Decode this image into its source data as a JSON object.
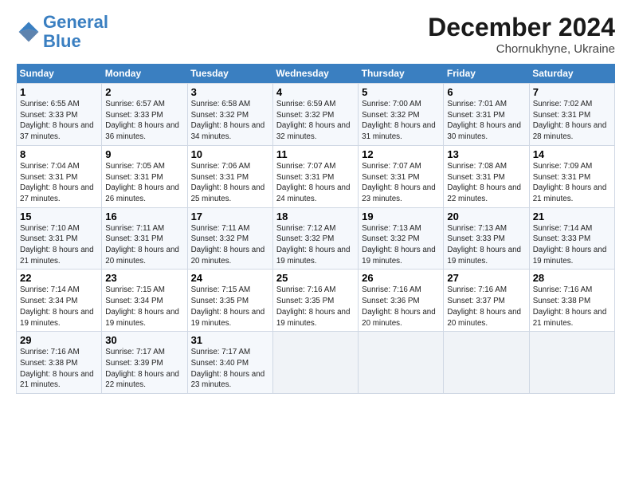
{
  "logo": {
    "line1": "General",
    "line2": "Blue"
  },
  "title": "December 2024",
  "subtitle": "Chornukhyne, Ukraine",
  "days_header": [
    "Sunday",
    "Monday",
    "Tuesday",
    "Wednesday",
    "Thursday",
    "Friday",
    "Saturday"
  ],
  "weeks": [
    [
      {
        "day": "1",
        "sunrise": "Sunrise: 6:55 AM",
        "sunset": "Sunset: 3:33 PM",
        "daylight": "Daylight: 8 hours and 37 minutes."
      },
      {
        "day": "2",
        "sunrise": "Sunrise: 6:57 AM",
        "sunset": "Sunset: 3:33 PM",
        "daylight": "Daylight: 8 hours and 36 minutes."
      },
      {
        "day": "3",
        "sunrise": "Sunrise: 6:58 AM",
        "sunset": "Sunset: 3:32 PM",
        "daylight": "Daylight: 8 hours and 34 minutes."
      },
      {
        "day": "4",
        "sunrise": "Sunrise: 6:59 AM",
        "sunset": "Sunset: 3:32 PM",
        "daylight": "Daylight: 8 hours and 32 minutes."
      },
      {
        "day": "5",
        "sunrise": "Sunrise: 7:00 AM",
        "sunset": "Sunset: 3:32 PM",
        "daylight": "Daylight: 8 hours and 31 minutes."
      },
      {
        "day": "6",
        "sunrise": "Sunrise: 7:01 AM",
        "sunset": "Sunset: 3:31 PM",
        "daylight": "Daylight: 8 hours and 30 minutes."
      },
      {
        "day": "7",
        "sunrise": "Sunrise: 7:02 AM",
        "sunset": "Sunset: 3:31 PM",
        "daylight": "Daylight: 8 hours and 28 minutes."
      }
    ],
    [
      {
        "day": "8",
        "sunrise": "Sunrise: 7:04 AM",
        "sunset": "Sunset: 3:31 PM",
        "daylight": "Daylight: 8 hours and 27 minutes."
      },
      {
        "day": "9",
        "sunrise": "Sunrise: 7:05 AM",
        "sunset": "Sunset: 3:31 PM",
        "daylight": "Daylight: 8 hours and 26 minutes."
      },
      {
        "day": "10",
        "sunrise": "Sunrise: 7:06 AM",
        "sunset": "Sunset: 3:31 PM",
        "daylight": "Daylight: 8 hours and 25 minutes."
      },
      {
        "day": "11",
        "sunrise": "Sunrise: 7:07 AM",
        "sunset": "Sunset: 3:31 PM",
        "daylight": "Daylight: 8 hours and 24 minutes."
      },
      {
        "day": "12",
        "sunrise": "Sunrise: 7:07 AM",
        "sunset": "Sunset: 3:31 PM",
        "daylight": "Daylight: 8 hours and 23 minutes."
      },
      {
        "day": "13",
        "sunrise": "Sunrise: 7:08 AM",
        "sunset": "Sunset: 3:31 PM",
        "daylight": "Daylight: 8 hours and 22 minutes."
      },
      {
        "day": "14",
        "sunrise": "Sunrise: 7:09 AM",
        "sunset": "Sunset: 3:31 PM",
        "daylight": "Daylight: 8 hours and 21 minutes."
      }
    ],
    [
      {
        "day": "15",
        "sunrise": "Sunrise: 7:10 AM",
        "sunset": "Sunset: 3:31 PM",
        "daylight": "Daylight: 8 hours and 21 minutes."
      },
      {
        "day": "16",
        "sunrise": "Sunrise: 7:11 AM",
        "sunset": "Sunset: 3:31 PM",
        "daylight": "Daylight: 8 hours and 20 minutes."
      },
      {
        "day": "17",
        "sunrise": "Sunrise: 7:11 AM",
        "sunset": "Sunset: 3:32 PM",
        "daylight": "Daylight: 8 hours and 20 minutes."
      },
      {
        "day": "18",
        "sunrise": "Sunrise: 7:12 AM",
        "sunset": "Sunset: 3:32 PM",
        "daylight": "Daylight: 8 hours and 19 minutes."
      },
      {
        "day": "19",
        "sunrise": "Sunrise: 7:13 AM",
        "sunset": "Sunset: 3:32 PM",
        "daylight": "Daylight: 8 hours and 19 minutes."
      },
      {
        "day": "20",
        "sunrise": "Sunrise: 7:13 AM",
        "sunset": "Sunset: 3:33 PM",
        "daylight": "Daylight: 8 hours and 19 minutes."
      },
      {
        "day": "21",
        "sunrise": "Sunrise: 7:14 AM",
        "sunset": "Sunset: 3:33 PM",
        "daylight": "Daylight: 8 hours and 19 minutes."
      }
    ],
    [
      {
        "day": "22",
        "sunrise": "Sunrise: 7:14 AM",
        "sunset": "Sunset: 3:34 PM",
        "daylight": "Daylight: 8 hours and 19 minutes."
      },
      {
        "day": "23",
        "sunrise": "Sunrise: 7:15 AM",
        "sunset": "Sunset: 3:34 PM",
        "daylight": "Daylight: 8 hours and 19 minutes."
      },
      {
        "day": "24",
        "sunrise": "Sunrise: 7:15 AM",
        "sunset": "Sunset: 3:35 PM",
        "daylight": "Daylight: 8 hours and 19 minutes."
      },
      {
        "day": "25",
        "sunrise": "Sunrise: 7:16 AM",
        "sunset": "Sunset: 3:35 PM",
        "daylight": "Daylight: 8 hours and 19 minutes."
      },
      {
        "day": "26",
        "sunrise": "Sunrise: 7:16 AM",
        "sunset": "Sunset: 3:36 PM",
        "daylight": "Daylight: 8 hours and 20 minutes."
      },
      {
        "day": "27",
        "sunrise": "Sunrise: 7:16 AM",
        "sunset": "Sunset: 3:37 PM",
        "daylight": "Daylight: 8 hours and 20 minutes."
      },
      {
        "day": "28",
        "sunrise": "Sunrise: 7:16 AM",
        "sunset": "Sunset: 3:38 PM",
        "daylight": "Daylight: 8 hours and 21 minutes."
      }
    ],
    [
      {
        "day": "29",
        "sunrise": "Sunrise: 7:16 AM",
        "sunset": "Sunset: 3:38 PM",
        "daylight": "Daylight: 8 hours and 21 minutes."
      },
      {
        "day": "30",
        "sunrise": "Sunrise: 7:17 AM",
        "sunset": "Sunset: 3:39 PM",
        "daylight": "Daylight: 8 hours and 22 minutes."
      },
      {
        "day": "31",
        "sunrise": "Sunrise: 7:17 AM",
        "sunset": "Sunset: 3:40 PM",
        "daylight": "Daylight: 8 hours and 23 minutes."
      },
      null,
      null,
      null,
      null
    ]
  ]
}
